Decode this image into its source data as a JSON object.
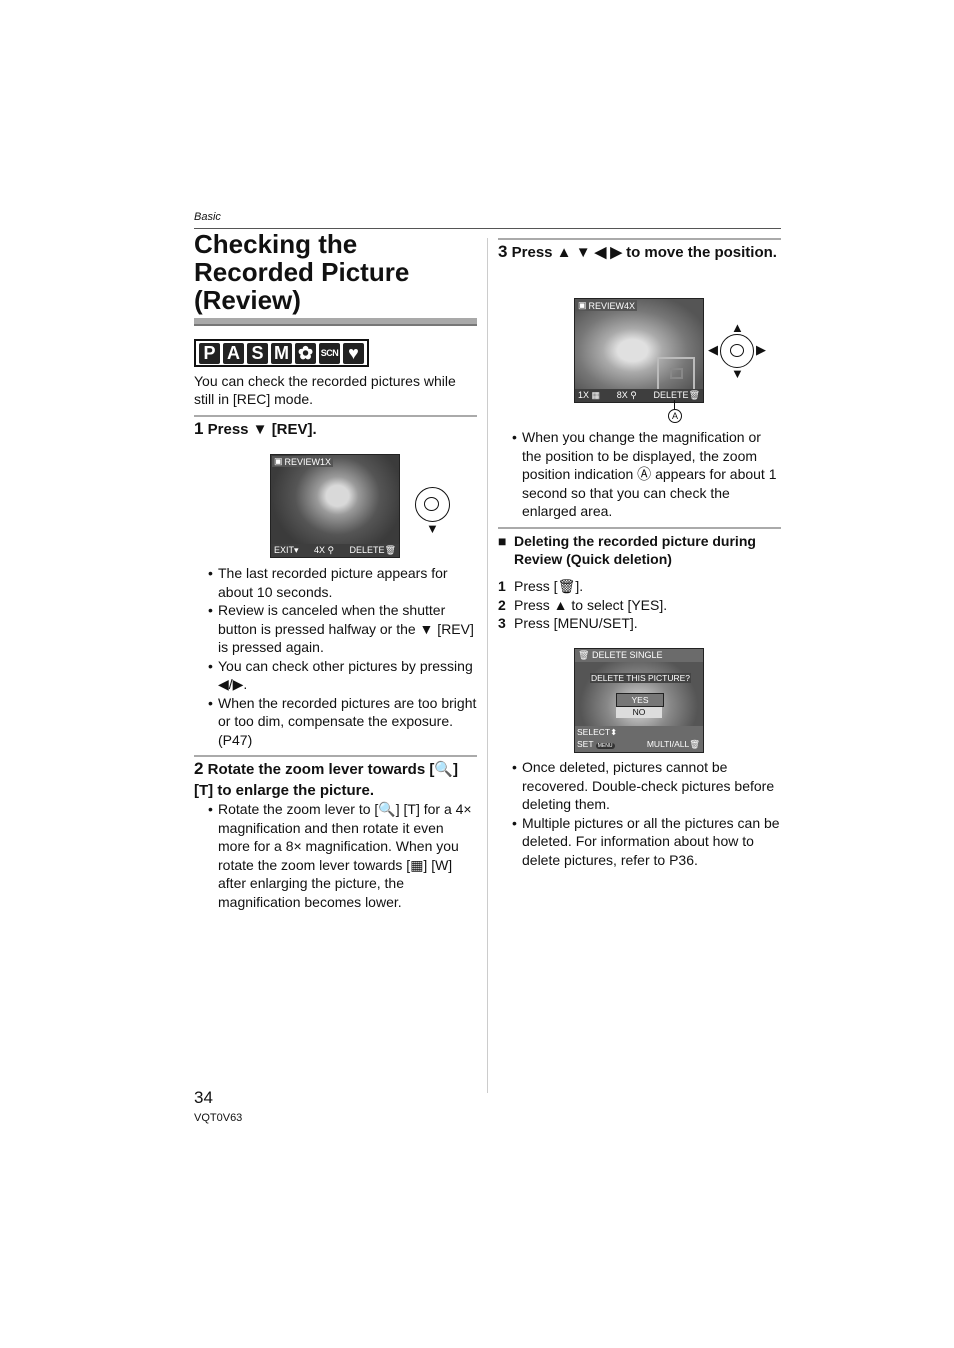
{
  "header": {
    "section": "Basic"
  },
  "title": "Checking the Recorded Picture (Review)",
  "mode_icons": [
    {
      "label": "P",
      "icon": "program-mode-icon"
    },
    {
      "label": "A",
      "icon": "aperture-priority-icon"
    },
    {
      "label": "S",
      "icon": "shutter-priority-icon"
    },
    {
      "label": "M",
      "icon": "manual-mode-icon"
    },
    {
      "label": "✿",
      "icon": "macro-mode-icon"
    },
    {
      "label": "SCN",
      "icon": "scene-mode-icon"
    },
    {
      "label": "♥",
      "icon": "simple-mode-icon"
    }
  ],
  "intro": "You can check the recorded pictures while still in [REC] mode.",
  "step1": {
    "num": "1",
    "heading": "Press ▼ [REV].",
    "lcd": {
      "top": "REVIEW1X",
      "exit": "EXIT",
      "zoom": "4X",
      "delete": "DELETE"
    },
    "bullets": [
      "The last recorded picture appears for about 10 seconds.",
      "Review is canceled when the shutter button is pressed halfway or the ▼ [REV] is pressed again.",
      "You can check other pictures by pressing ◀/▶.",
      "When the recorded pictures are too bright or too dim, compensate the exposure. (P47)"
    ]
  },
  "step2": {
    "num": "2",
    "heading": "Rotate the zoom lever towards [🔍] [T] to enlarge the picture.",
    "bullets": [
      "Rotate the zoom lever to [🔍] [T] for a 4× magnification and then rotate it even more for a 8× magnification. When you rotate the zoom lever towards [▦] [W] after enlarging the picture, the magnification becomes lower."
    ]
  },
  "step3": {
    "num": "3",
    "heading": "Press ▲ ▼ ◀ ▶ to move the position.",
    "lcd": {
      "top": "REVIEW4X",
      "left": "1X",
      "zoom": "8X",
      "delete": "DELETE",
      "callout": "A"
    },
    "bullets": [
      "When you change the magnification or the position to be displayed, the zoom position indication Ⓐ appears for about 1 second so that you can check the enlarged area."
    ]
  },
  "quick_delete": {
    "heading": "Deleting the recorded picture during Review (Quick deletion)",
    "steps": [
      {
        "num": "1",
        "text": "Press [🗑]."
      },
      {
        "num": "2",
        "text": "Press ▲ to select [YES]."
      },
      {
        "num": "3",
        "text": "Press [MENU/SET]."
      }
    ],
    "lcd": {
      "title": "DELETE SINGLE",
      "question": "DELETE THIS PICTURE?",
      "yes": "YES",
      "no": "NO",
      "select": "SELECT",
      "set": "SET",
      "menu": "MENU",
      "multi": "MULTI/ALL"
    },
    "bullets": [
      "Once deleted, pictures cannot be recovered. Double-check pictures before deleting them.",
      "Multiple pictures or all the pictures can be deleted. For information about how to delete pictures, refer to P36."
    ]
  },
  "footer": {
    "page": "34",
    "code": "VQT0V63"
  }
}
